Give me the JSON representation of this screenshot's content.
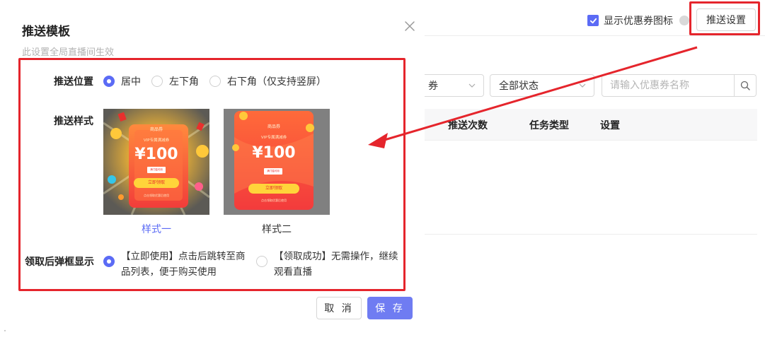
{
  "background": {
    "show_coupon_icon_label": "显示优惠券图标",
    "show_coupon_icon_checked": true,
    "push_settings_button": "推送设置",
    "filters": {
      "type_select_value": "券",
      "status_select_value": "全部状态",
      "search_placeholder": "请输入优惠券名称"
    },
    "table_headers": [
      "推送次数",
      "任务类型",
      "设置"
    ]
  },
  "modal": {
    "title": "推送模板",
    "subtitle": "此设置全局直播间生效",
    "position": {
      "label": "推送位置",
      "options": [
        "居中",
        "左下角",
        "右下角（仅支持竖屏）"
      ],
      "selected": "居中"
    },
    "style": {
      "label": "推送样式",
      "options": [
        {
          "caption": "样式一",
          "selected": true,
          "card": {
            "heading": "商品券",
            "subheading": "VIP专属满减券",
            "amount": "¥100",
            "tag": "满门槛可用",
            "button": "立即领取",
            "footer": "点击领取优惠后使用"
          }
        },
        {
          "caption": "样式二",
          "selected": false,
          "card": {
            "heading": "商品券",
            "subheading": "VIP专属满减券",
            "amount": "¥100",
            "tag": "满门槛可用",
            "button": "立即领取",
            "footer": "点击领取优惠后使用"
          }
        }
      ]
    },
    "after_claim": {
      "label": "领取后弹框显示",
      "options": [
        {
          "text": "【立即使用】点击后跳转至商品列表，便于购买使用",
          "selected": true
        },
        {
          "text": "【领取成功】无需操作，继续观看直播",
          "selected": false
        }
      ]
    },
    "buttons": {
      "cancel": "取 消",
      "save": "保 存"
    }
  },
  "colors": {
    "accent": "#5b6bf5",
    "save_button": "#6f7cf2",
    "annotation_red": "#e5252c",
    "coupon_orange": "#f4503c",
    "coupon_yellow": "#ffd43a"
  },
  "icons": [
    "close-icon",
    "check-icon",
    "chevron-down-icon",
    "search-icon",
    "help-icon"
  ]
}
